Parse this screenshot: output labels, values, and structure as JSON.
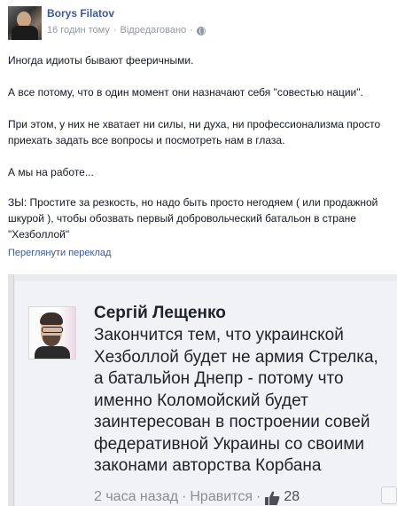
{
  "post": {
    "author": "Borys Filatov",
    "time": "16 годин тому",
    "separator": "·",
    "edited": "Відредаговано",
    "separator2": "·",
    "paragraphs": [
      "Иногда идиоты бывают фееричными.",
      "А все потому, что в один момент они назначают себя \"совестью нации\".",
      "При этом, у них не хватает ни силы, ни духа, ни профессионализма просто приехать задать все вопросы и посмотреть нам в глаза.",
      "А мы на работе...",
      "ЗЫ: Простите за резкость, но надо быть просто негодяем ( или продажной шкурой ), чтобы обозвать первый добровольческий батальон в стране \"Хезболлой\""
    ],
    "translate_link": "Переглянути переклад"
  },
  "quoted_comment": {
    "author": "Сергій Лещенко",
    "text": "Закончится тем, что украинской Хезболлой будет не армия Стрелка, а батальйон Днепр - потому что именно Коломойский будет заинтересован в построении совей федеративной Украины со своими законами авторства Корбана",
    "time": "2 часа назад",
    "separator": "·",
    "like_label": "Нравится",
    "separator2": "·",
    "likes": "28"
  },
  "colors": {
    "link": "#3b5998",
    "meta": "#9197a3",
    "text": "#141823"
  },
  "icons": {
    "globe": "globe-icon",
    "thumbs_up": "thumbs-up-icon"
  }
}
